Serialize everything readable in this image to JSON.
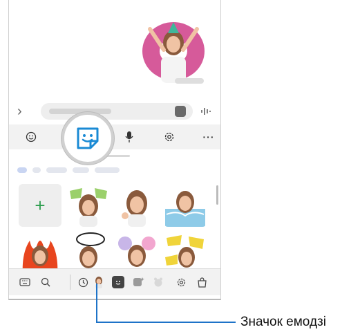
{
  "toolbar": {
    "icons": [
      "smiley-icon",
      "sticker-icon",
      "microphone-icon",
      "gear-icon",
      "more-icon"
    ],
    "more_label": "···"
  },
  "input": {
    "expand_label": "›"
  },
  "grid": {
    "add_label": "+"
  },
  "bottom_bar": {
    "icons": [
      "keyboard-icon",
      "search-icon",
      "recent-icon",
      "ar-emoji-icon",
      "sticker-icon",
      "bitmoji-icon",
      "gif-icon",
      "settings-icon",
      "store-icon"
    ]
  },
  "callout": {
    "label": "Значок емодзі"
  },
  "colors": {
    "callout_line": "#1e73c8",
    "sticker_accent": "#1a8ad4",
    "add_plus": "#2e9e4f"
  }
}
